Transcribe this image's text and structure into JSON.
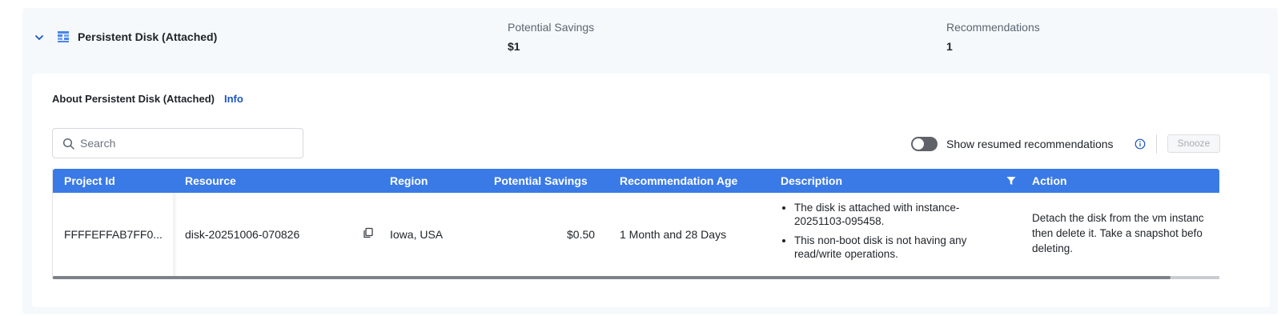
{
  "header": {
    "service_title": "Persistent Disk (Attached)",
    "savings_label": "Potential Savings",
    "savings_value": "$1",
    "recs_label": "Recommendations",
    "recs_value": "1",
    "service_icon": "persistent-disk-icon",
    "expand_icon": "chevron-down-icon"
  },
  "about": {
    "title": "About Persistent Disk (Attached)",
    "info_link": "Info"
  },
  "toolbar": {
    "search_placeholder": "Search",
    "toggle_label": "Show resumed recommendations",
    "toggle_on": false,
    "snooze_label": "Snooze"
  },
  "table": {
    "columns": [
      "Project Id",
      "Resource",
      "Region",
      "Potential Savings",
      "Recommendation Age",
      "Description",
      "Action"
    ],
    "rows": [
      {
        "project_id": "FFFFEFFAB7FF0...",
        "resource": "disk-20251006-070826",
        "region": "Iowa, USA",
        "savings": "$0.50",
        "age": "1 Month and 28 Days",
        "description": [
          "The disk is attached with instance-20251103-095458.",
          "This non-boot disk is not having any read/write operations."
        ],
        "action_lines": [
          "Detach the disk from the vm instanc",
          "then delete it. Take a snapshot befo",
          "deleting."
        ]
      }
    ]
  },
  "colors": {
    "accent": "#3a7ae6",
    "link": "#1a56c4",
    "panel_bg": "#f5f9fc"
  }
}
